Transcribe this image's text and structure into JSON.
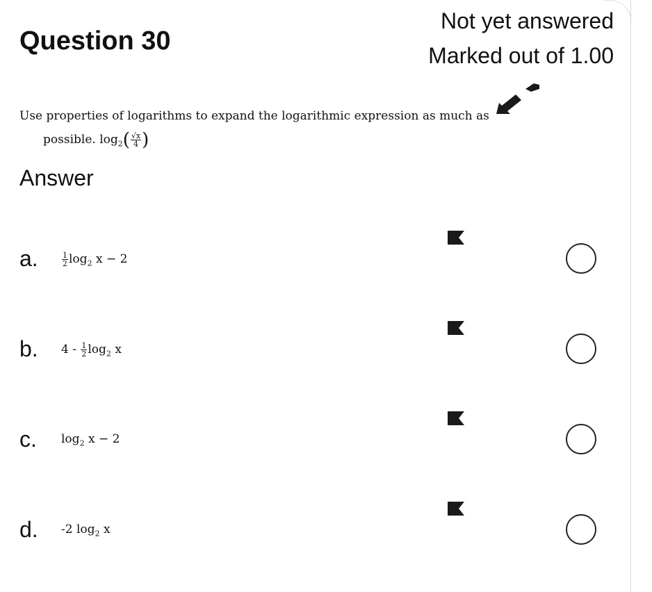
{
  "question": {
    "title": "Question 30",
    "state": "Not yet answered",
    "grade": "Marked out of 1.00",
    "text_line1": "Use properties of logarithms to expand the logarithmic expression as much as",
    "text_line2": "possible.",
    "expression": {
      "log": "log",
      "base": "2",
      "numerator": "√x",
      "denominator": "4"
    }
  },
  "answer_label": "Answer",
  "options": [
    {
      "letter": "a.",
      "prefix": "",
      "frac_num": "1",
      "frac_den": "2",
      "log": "log",
      "base": "2",
      "suffix": "x − 2",
      "selected": false
    },
    {
      "letter": "b.",
      "prefix": "4 - ",
      "frac_num": "1",
      "frac_den": "2",
      "log": "log",
      "base": "2",
      "suffix": "x",
      "selected": false
    },
    {
      "letter": "c.",
      "prefix": "",
      "log": "log",
      "base": "2",
      "suffix": "x − 2",
      "selected": false
    },
    {
      "letter": "d.",
      "prefix": "-2 ",
      "log": "log",
      "base": "2",
      "suffix": "x",
      "selected": false
    }
  ],
  "colors": {
    "text": "#111111",
    "border": "#d9d9d9",
    "mark": "#1a1a1a"
  },
  "icons": {
    "flag": "flag-icon",
    "pointer": "arrow-annotation-icon"
  }
}
